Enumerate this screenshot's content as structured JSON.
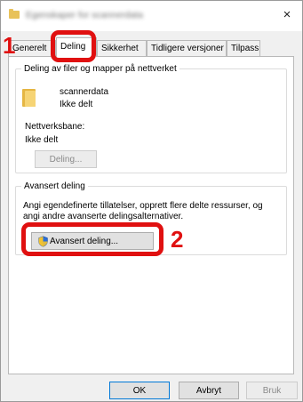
{
  "window": {
    "title": "Egenskaper for scannerdata",
    "close_glyph": "×"
  },
  "tabs": [
    {
      "label": "Generelt"
    },
    {
      "label": "Deling",
      "active": true
    },
    {
      "label": "Sikkerhet"
    },
    {
      "label": "Tidligere versjoner"
    },
    {
      "label": "Tilpass"
    }
  ],
  "sharing": {
    "group_title": "Deling av filer og mapper på nettverket",
    "folder_icon": "folder-icon",
    "folder_name": "scannerdata",
    "folder_status": "Ikke delt",
    "path_label": "Nettverksbane:",
    "path_value": "Ikke delt",
    "share_button": "Deling..."
  },
  "advanced": {
    "group_title": "Avansert deling",
    "description": [
      "Angi egendefinerte tillatelser, opprett flere delte ressurser, og",
      "angi andre avanserte delingsalternativer."
    ],
    "button_icon": "shield-icon",
    "button_label": "Avansert deling..."
  },
  "footer": {
    "ok": "OK",
    "cancel": "Avbryt",
    "apply": "Bruk"
  },
  "annotations": {
    "step1": "1",
    "step2": "2",
    "color": "#e01010"
  }
}
